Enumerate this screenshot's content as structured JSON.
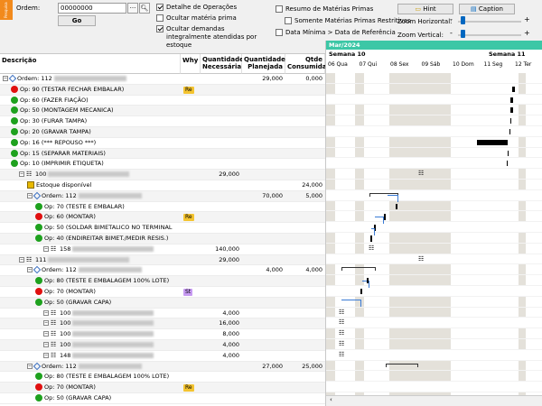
{
  "side_tab": "Pesquisa",
  "order": {
    "label": "Ordem:",
    "value": "00000000",
    "go": "Go"
  },
  "options_left": [
    {
      "label": "Detalhe de Operações",
      "checked": true
    },
    {
      "label": "Ocultar matéria prima",
      "checked": false
    },
    {
      "label": "Ocultar demandas integralmente atendidas por estoque",
      "checked": true
    }
  ],
  "options_mid": [
    {
      "label": "Resumo de Matérias Primas",
      "checked": false
    },
    {
      "label": "Somente Matérias Primas Restritivas",
      "checked": false
    },
    {
      "label": "Data Mínima > Data de Referência",
      "checked": false
    }
  ],
  "buttons": {
    "hint": "Hint",
    "caption": "Caption"
  },
  "zoom": {
    "horizontal": "Zoom Horizontal:",
    "vertical": "Zoom Vertical:"
  },
  "columns": {
    "desc": "Descrição",
    "why": "Why",
    "qn": "Quantidade Necessária",
    "qp": "Quantidade Planejada",
    "qc": "Qtde Consumida"
  },
  "rows": [
    {
      "indent": 0,
      "icon": "order",
      "text": "Ordem: 112",
      "blur": 80,
      "why": "",
      "qn": "",
      "qp": "29,000",
      "qc": "0,000"
    },
    {
      "indent": 1,
      "icon": "red",
      "text": "Op: 90 (TESTAR FECHAR EMBALAR)",
      "why": "Re",
      "qn": "",
      "qp": "",
      "qc": ""
    },
    {
      "indent": 1,
      "icon": "green",
      "text": "Op: 60 (FAZER FIAÇÃO)",
      "why": "",
      "qn": "",
      "qp": "",
      "qc": ""
    },
    {
      "indent": 1,
      "icon": "green",
      "text": "Op: 50 (MONTAGEM MECANICA)",
      "why": "",
      "qn": "",
      "qp": "",
      "qc": ""
    },
    {
      "indent": 1,
      "icon": "green",
      "text": "Op: 30 (FURAR TAMPA)",
      "why": "",
      "qn": "",
      "qp": "",
      "qc": ""
    },
    {
      "indent": 1,
      "icon": "green",
      "text": "Op: 20 (GRAVAR TAMPA)",
      "why": "",
      "qn": "",
      "qp": "",
      "qc": ""
    },
    {
      "indent": 1,
      "icon": "green",
      "text": "Op: 16 (*** REPOUSO ***)",
      "why": "",
      "qn": "",
      "qp": "",
      "qc": ""
    },
    {
      "indent": 1,
      "icon": "green",
      "text": "Op: 15 (SEPARAR MATERIAIS)",
      "why": "",
      "qn": "",
      "qp": "",
      "qc": ""
    },
    {
      "indent": 1,
      "icon": "green",
      "text": "Op: 10 (IMPRIMIR ETIQUETA)",
      "why": "",
      "qn": "",
      "qp": "",
      "qc": ""
    },
    {
      "indent": 2,
      "icon": "bom",
      "text": "100",
      "blur": 90,
      "why": "",
      "qn": "29,000",
      "qp": "",
      "qc": ""
    },
    {
      "indent": 3,
      "icon": "stock",
      "text": "Estoque disponível",
      "why": "",
      "qn": "",
      "qp": "",
      "qc": "24,000"
    },
    {
      "indent": 3,
      "icon": "order",
      "text": "Ordem: 112",
      "blur": 70,
      "why": "",
      "qn": "",
      "qp": "70,000",
      "qc": "5,000"
    },
    {
      "indent": 4,
      "icon": "green",
      "text": "Op: 70 (TESTE E EMBALAR)",
      "why": "",
      "qn": "",
      "qp": "",
      "qc": ""
    },
    {
      "indent": 4,
      "icon": "red",
      "text": "Op: 60 (MONTAR)",
      "why": "Re",
      "qn": "",
      "qp": "",
      "qc": ""
    },
    {
      "indent": 4,
      "icon": "green",
      "text": "Op: 50 (SOLDAR BIMETALICO NO TERMINAL",
      "why": "",
      "qn": "",
      "qp": "",
      "qc": ""
    },
    {
      "indent": 4,
      "icon": "green",
      "text": "Op: 40 (ENDIREITAR BIMET./MEDIR RESIS.)",
      "why": "",
      "qn": "",
      "qp": "",
      "qc": ""
    },
    {
      "indent": 5,
      "icon": "bom",
      "text": "158",
      "blur": 90,
      "why": "",
      "qn": "140,000",
      "qp": "",
      "qc": ""
    },
    {
      "indent": 2,
      "icon": "bom",
      "text": "111",
      "blur": 90,
      "why": "",
      "qn": "29,000",
      "qp": "",
      "qc": ""
    },
    {
      "indent": 3,
      "icon": "order",
      "text": "Ordem: 112",
      "blur": 70,
      "why": "",
      "qn": "",
      "qp": "4,000",
      "qc": "4,000"
    },
    {
      "indent": 4,
      "icon": "green",
      "text": "Op: 80 (TESTE E EMBALAGEM 100% LOTE)",
      "why": "",
      "qn": "",
      "qp": "",
      "qc": ""
    },
    {
      "indent": 4,
      "icon": "red",
      "text": "Op: 70 (MONTAR)",
      "why": "St",
      "qn": "",
      "qp": "",
      "qc": ""
    },
    {
      "indent": 4,
      "icon": "green",
      "text": "Op: 50 (GRAVAR CAPA)",
      "why": "",
      "qn": "",
      "qp": "",
      "qc": ""
    },
    {
      "indent": 5,
      "icon": "bom",
      "text": "100",
      "blur": 90,
      "why": "",
      "qn": "4,000",
      "qp": "",
      "qc": ""
    },
    {
      "indent": 5,
      "icon": "bom",
      "text": "100",
      "blur": 90,
      "why": "",
      "qn": "16,000",
      "qp": "",
      "qc": ""
    },
    {
      "indent": 5,
      "icon": "bom",
      "text": "100",
      "blur": 90,
      "why": "",
      "qn": "8,000",
      "qp": "",
      "qc": ""
    },
    {
      "indent": 5,
      "icon": "bom",
      "text": "100",
      "blur": 90,
      "why": "",
      "qn": "4,000",
      "qp": "",
      "qc": ""
    },
    {
      "indent": 5,
      "icon": "bom",
      "text": "148",
      "blur": 90,
      "why": "",
      "qn": "4,000",
      "qp": "",
      "qc": ""
    },
    {
      "indent": 3,
      "icon": "order",
      "text": "Ordem: 112",
      "blur": 70,
      "why": "",
      "qn": "",
      "qp": "27,000",
      "qc": "25,000"
    },
    {
      "indent": 4,
      "icon": "green",
      "text": "Op: 80 (TESTE E EMBALAGEM 100% LOTE)",
      "why": "",
      "qn": "",
      "qp": "",
      "qc": ""
    },
    {
      "indent": 4,
      "icon": "red",
      "text": "Op: 70 (MONTAR)",
      "why": "Re",
      "qn": "",
      "qp": "",
      "qc": ""
    },
    {
      "indent": 4,
      "icon": "green",
      "text": "Op: 50 (GRAVAR CAPA)",
      "why": "",
      "qn": "",
      "qp": "",
      "qc": ""
    }
  ],
  "gantt": {
    "month": "Mar/2024",
    "weeks": [
      "Semana 10",
      "Semana 11"
    ],
    "days": [
      "06 Qua",
      "07 Qui",
      "08 Sex",
      "09 Sáb",
      "10 Dom",
      "11 Seg",
      "12 Ter"
    ]
  }
}
